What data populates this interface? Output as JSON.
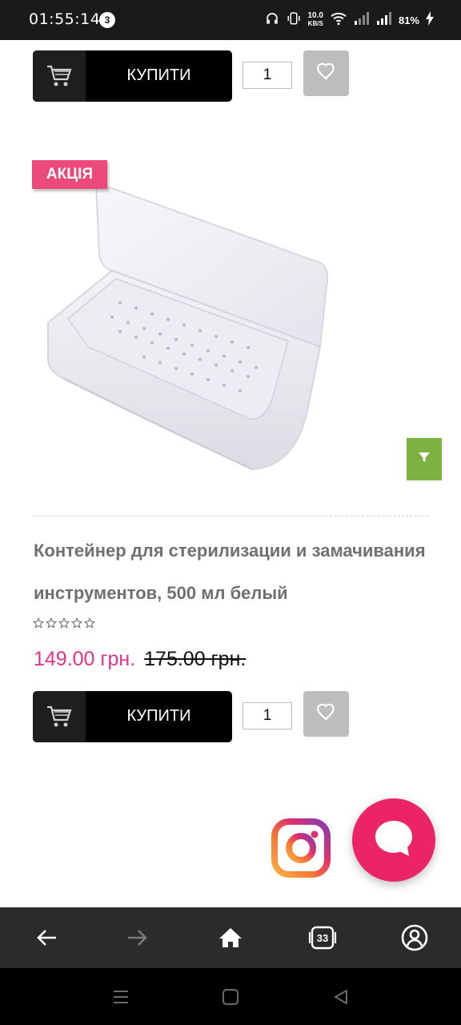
{
  "status_bar": {
    "time": "01:55:14",
    "notification_count": "3",
    "network_speed_value": "10.0",
    "network_speed_unit": "KB/S",
    "battery": "81%"
  },
  "top_row": {
    "buy_label": "КУПИТИ",
    "quantity": "1"
  },
  "product": {
    "badge": "АКЦІЯ",
    "title": "Контейнер для стерилизации и замачивания инструментов, 500 мл белый",
    "rating_stars": 0,
    "price_new": "149.00 грн.",
    "price_old": "175.00 грн.",
    "buy_label": "КУПИТИ",
    "quantity": "1"
  },
  "browser_nav": {
    "tab_count": "33"
  },
  "colors": {
    "accent_pink": "#e0338a",
    "badge_pink": "#ec4a7a",
    "chat_pink": "#ea2467",
    "filter_green": "#7cb342"
  }
}
